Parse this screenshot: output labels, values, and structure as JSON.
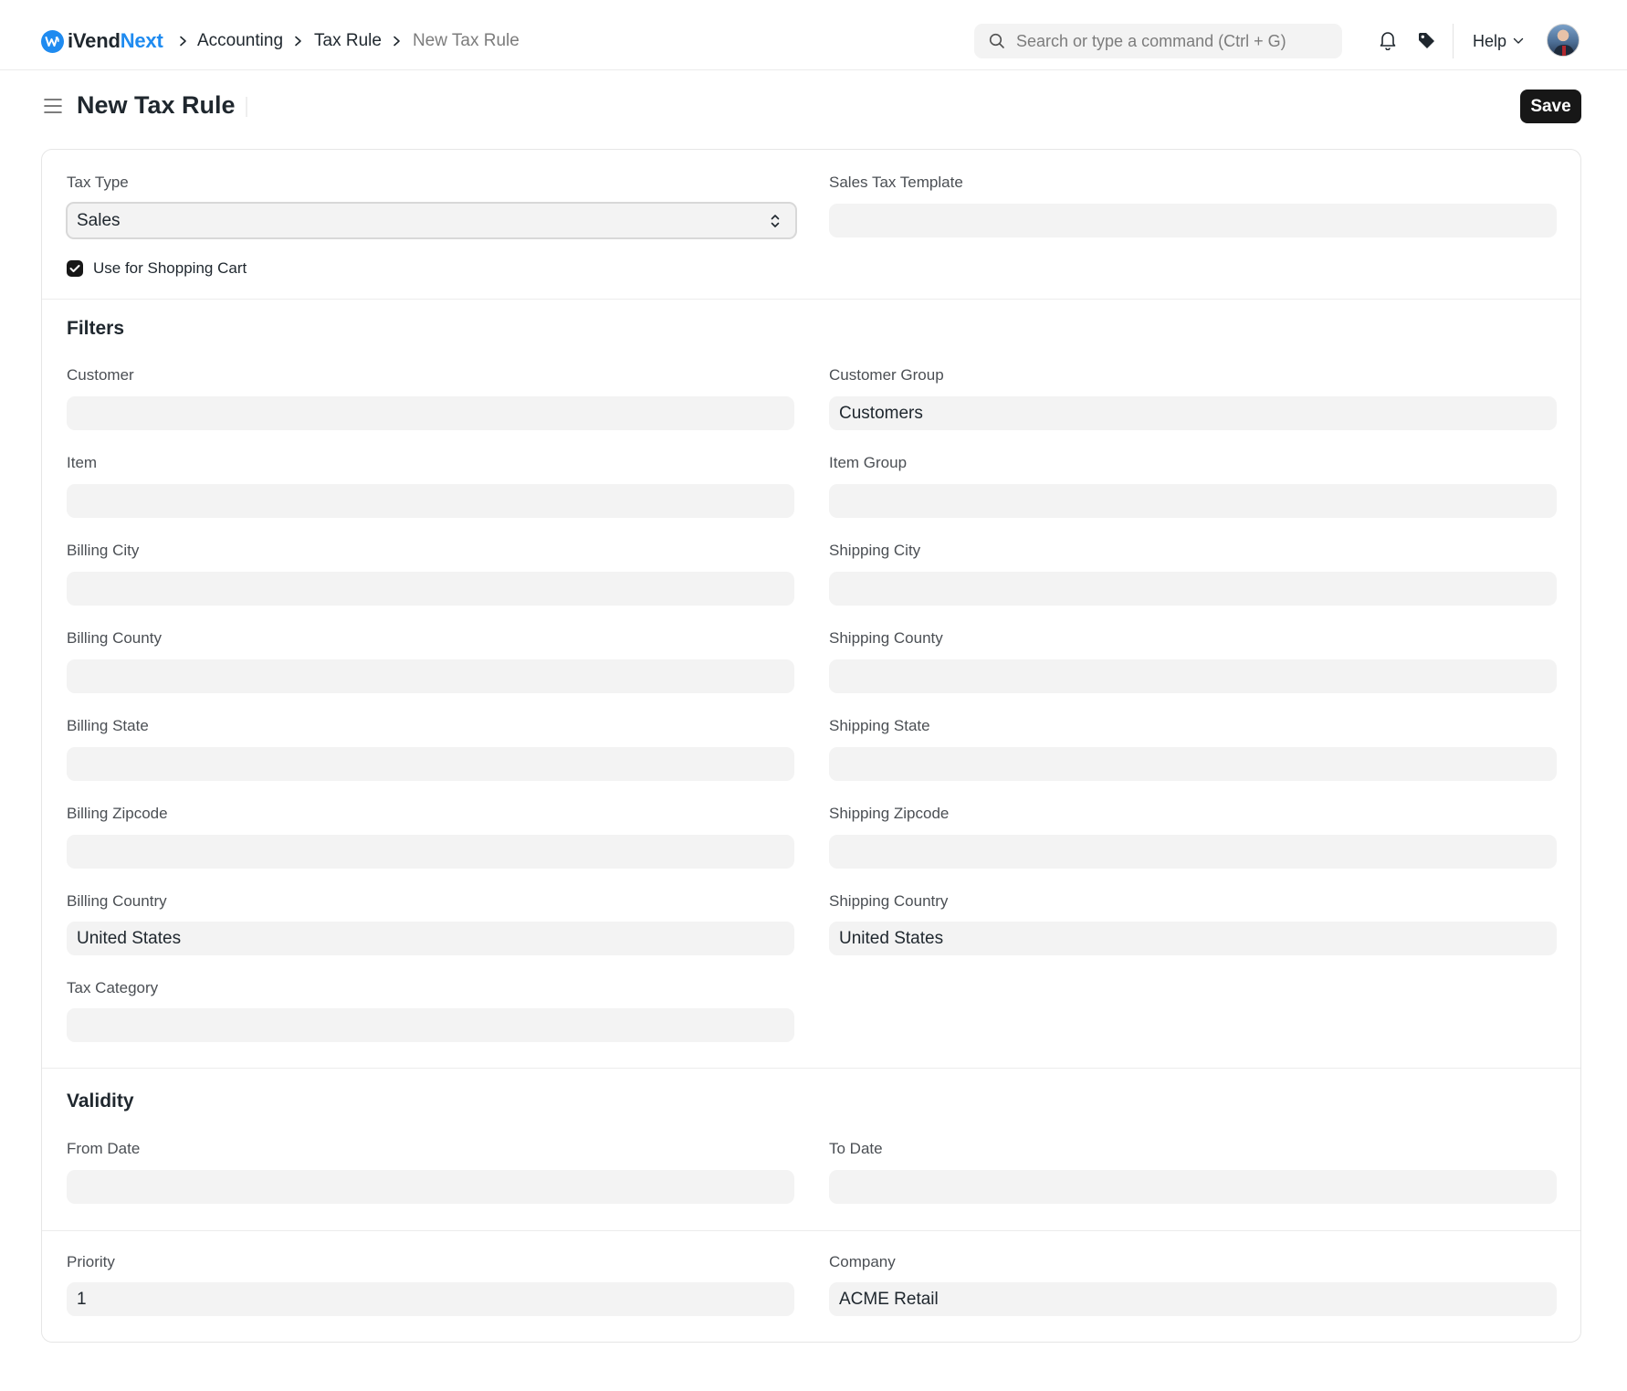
{
  "app": {
    "logo_prefix": "iVend",
    "logo_accent": "Next",
    "brand_color": "#1f8bf0"
  },
  "breadcrumb": [
    "Accounting",
    "Tax Rule",
    "New Tax Rule"
  ],
  "search": {
    "placeholder": "Search or type a command (Ctrl + G)"
  },
  "navbar": {
    "help_label": "Help",
    "icons": [
      "bell-icon",
      "tag-icon",
      "chevron-down-icon",
      "avatar"
    ]
  },
  "page": {
    "title": "New Tax Rule",
    "save_label": "Save"
  },
  "form": {
    "tax_type": {
      "label": "Tax Type",
      "value": "Sales"
    },
    "sales_tax_template": {
      "label": "Sales Tax Template",
      "value": ""
    },
    "use_for_shopping_cart": {
      "label": "Use for Shopping Cart",
      "checked": true
    },
    "filters": {
      "title": "Filters",
      "customer": {
        "label": "Customer",
        "value": ""
      },
      "customer_group": {
        "label": "Customer Group",
        "value": "Customers"
      },
      "item": {
        "label": "Item",
        "value": ""
      },
      "item_group": {
        "label": "Item Group",
        "value": ""
      },
      "billing_city": {
        "label": "Billing City",
        "value": ""
      },
      "shipping_city": {
        "label": "Shipping City",
        "value": ""
      },
      "billing_county": {
        "label": "Billing County",
        "value": ""
      },
      "shipping_county": {
        "label": "Shipping County",
        "value": ""
      },
      "billing_state": {
        "label": "Billing State",
        "value": ""
      },
      "shipping_state": {
        "label": "Shipping State",
        "value": ""
      },
      "billing_zipcode": {
        "label": "Billing Zipcode",
        "value": ""
      },
      "shipping_zipcode": {
        "label": "Shipping Zipcode",
        "value": ""
      },
      "billing_country": {
        "label": "Billing Country",
        "value": "United States"
      },
      "shipping_country": {
        "label": "Shipping Country",
        "value": "United States"
      },
      "tax_category": {
        "label": "Tax Category",
        "value": ""
      }
    },
    "validity": {
      "title": "Validity",
      "from_date": {
        "label": "From Date",
        "value": ""
      },
      "to_date": {
        "label": "To Date",
        "value": ""
      }
    },
    "priority": {
      "label": "Priority",
      "value": "1"
    },
    "company": {
      "label": "Company",
      "value": "ACME Retail"
    }
  }
}
